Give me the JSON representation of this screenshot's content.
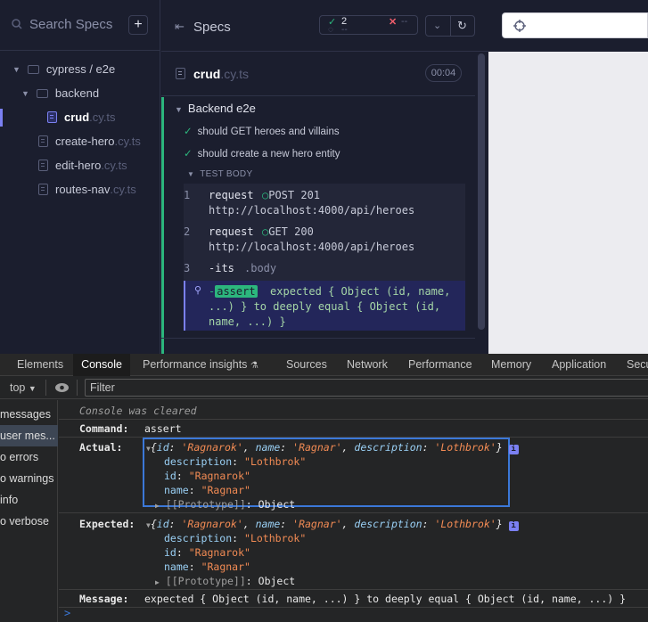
{
  "specs": {
    "search_placeholder": "Search Specs",
    "add_label": "+",
    "tree": [
      {
        "label": "cypress / e2e",
        "ext": "",
        "type": "folder"
      },
      {
        "label": "backend",
        "ext": "",
        "type": "folder"
      },
      {
        "label": "crud",
        "ext": ".cy.ts",
        "type": "file",
        "active": true
      },
      {
        "label": "create-hero",
        "ext": ".cy.ts",
        "type": "file"
      },
      {
        "label": "edit-hero",
        "ext": ".cy.ts",
        "type": "file"
      },
      {
        "label": "routes-nav",
        "ext": ".cy.ts",
        "type": "file"
      }
    ]
  },
  "reporter": {
    "title": "Specs",
    "passed": "2",
    "failed": "--",
    "pending": "--",
    "file_name": "crud",
    "file_ext": ".cy.ts",
    "duration": "00:04",
    "suite": "Backend e2e",
    "tests": [
      "should GET heroes and villains",
      "should create a new hero entity"
    ],
    "test_body_label": "TEST BODY",
    "commands": [
      {
        "num": "1",
        "name": "request",
        "method": "POST 201",
        "url": "http://localhost:4000/api/heroes"
      },
      {
        "num": "2",
        "name": "request",
        "method": "GET 200",
        "url": "http://localhost:4000/api/heroes"
      },
      {
        "num": "3",
        "name": "-its",
        "detail": ".body"
      }
    ],
    "assert": {
      "dash": "-",
      "badge": "assert",
      "line1": "expected { Object (id, name,",
      "line2": "...) } to deeply equal { Object (id,",
      "line3": "name, ...) }"
    }
  },
  "devtools": {
    "tabs": [
      "Elements",
      "Console",
      "Performance insights",
      "Sources",
      "Network",
      "Performance",
      "Memory",
      "Application",
      "Secu"
    ],
    "active_tab": "Console",
    "context": "top",
    "filter_placeholder": "Filter",
    "sidebar": [
      "messages",
      "user mes...",
      "o errors",
      "o warnings",
      "info",
      "o verbose"
    ],
    "console": {
      "cleared": "Console was cleared",
      "command_label": "Command:",
      "command_value": "assert",
      "actual_label": "Actual:",
      "expected_label": "Expected:",
      "object_summary": {
        "id_key": "id",
        "id_val": "'Ragnarok'",
        "name_key": "name",
        "name_val": "'Ragnar'",
        "desc_key": "description",
        "desc_val": "'Lothbrok'"
      },
      "props": [
        {
          "key": "description",
          "val": "\"Lothbrok\""
        },
        {
          "key": "id",
          "val": "\"Ragnarok\""
        },
        {
          "key": "name",
          "val": "\"Ragnar\""
        }
      ],
      "prototype": "[[Prototype]]",
      "prototype_val": "Object",
      "message_label": "Message:",
      "message_value": "expected { Object (id, name, ...) } to deeply equal { Object (id, name, ...) }",
      "prompt": ">"
    }
  }
}
